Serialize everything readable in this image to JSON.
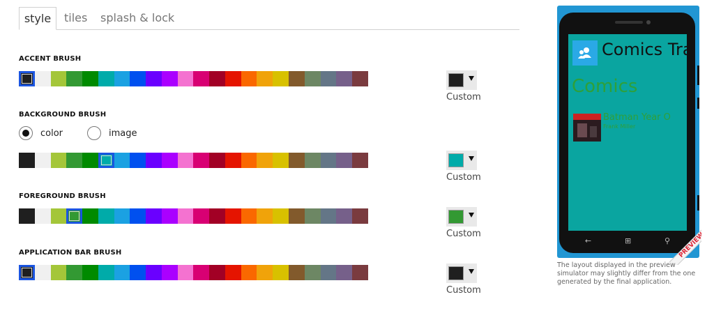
{
  "tabs": [
    {
      "label": "style",
      "active": true
    },
    {
      "label": "tiles",
      "active": false
    },
    {
      "label": "splash & lock",
      "active": false
    }
  ],
  "palette_colors": [
    "#1f1f1f",
    "#f0f0f0",
    "#a4c639",
    "#339933",
    "#008a00",
    "#00aba9",
    "#1ba1e2",
    "#0050ef",
    "#6a00ff",
    "#aa00ff",
    "#f472d0",
    "#d80073",
    "#a20025",
    "#e51400",
    "#fa6800",
    "#f0a30a",
    "#d8c100",
    "#825a2c",
    "#6d8764",
    "#647687",
    "#76608a",
    "#7a3b3f"
  ],
  "sections": {
    "accent": {
      "label": "ACCENT BRUSH",
      "selected_index": 0,
      "custom_color": "#1f1f1f",
      "custom_label": "Custom"
    },
    "background": {
      "label": "BACKGROUND BRUSH",
      "selected_index": 5,
      "custom_color": "#00aba9",
      "custom_label": "Custom",
      "radio_options": [
        {
          "label": "color",
          "checked": true
        },
        {
          "label": "image",
          "checked": false
        }
      ]
    },
    "foreground": {
      "label": "FOREGROUND BRUSH",
      "selected_index": 3,
      "custom_color": "#339933",
      "custom_label": "Custom"
    },
    "appbar": {
      "label": "APPLICATION BAR BRUSH",
      "selected_index": 0,
      "custom_color": "#1f1f1f",
      "custom_label": "Custom"
    }
  },
  "preview": {
    "app_title": "Comics Tra",
    "panorama_title": "Comics",
    "item_title": "Batman Year O",
    "item_subtitle": "Frank Miller",
    "ribbon": "PREVIEW",
    "note": "The layout displayed in the preview simulator may slightly differ from the one generated by the final application."
  }
}
